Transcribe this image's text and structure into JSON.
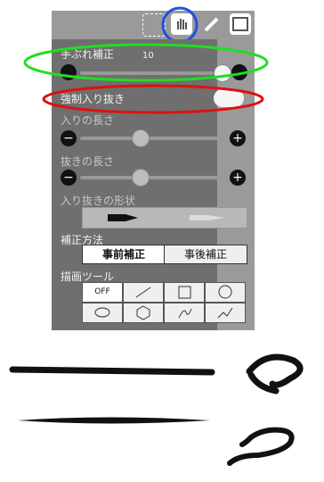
{
  "toolbar": {
    "icons": [
      "selection-icon",
      "hand-icon",
      "pencil-icon",
      "image-icon"
    ],
    "active": "hand-icon"
  },
  "panel": {
    "stabilizer": {
      "label": "手ぶれ補正",
      "value": "10"
    },
    "force_taper": {
      "label": "強制入り抜き"
    },
    "taper_in": {
      "label": "入りの長さ"
    },
    "taper_out": {
      "label": "抜きの長さ"
    },
    "taper_shape": {
      "label": "入り抜きの形状"
    },
    "correction": {
      "label": "補正方法",
      "options": [
        "事前補正",
        "事後補正"
      ],
      "selected": "事前補正"
    },
    "draw_tool": {
      "label": "描画ツール",
      "off_label": "OFF",
      "tools": [
        "off",
        "line",
        "rectangle",
        "ellipse-circle",
        "ellipse",
        "polygon",
        "curve",
        "polyline"
      ]
    }
  },
  "annotations": {
    "green": "#22dd22",
    "red": "#e01010",
    "blue": "#2050e0"
  }
}
